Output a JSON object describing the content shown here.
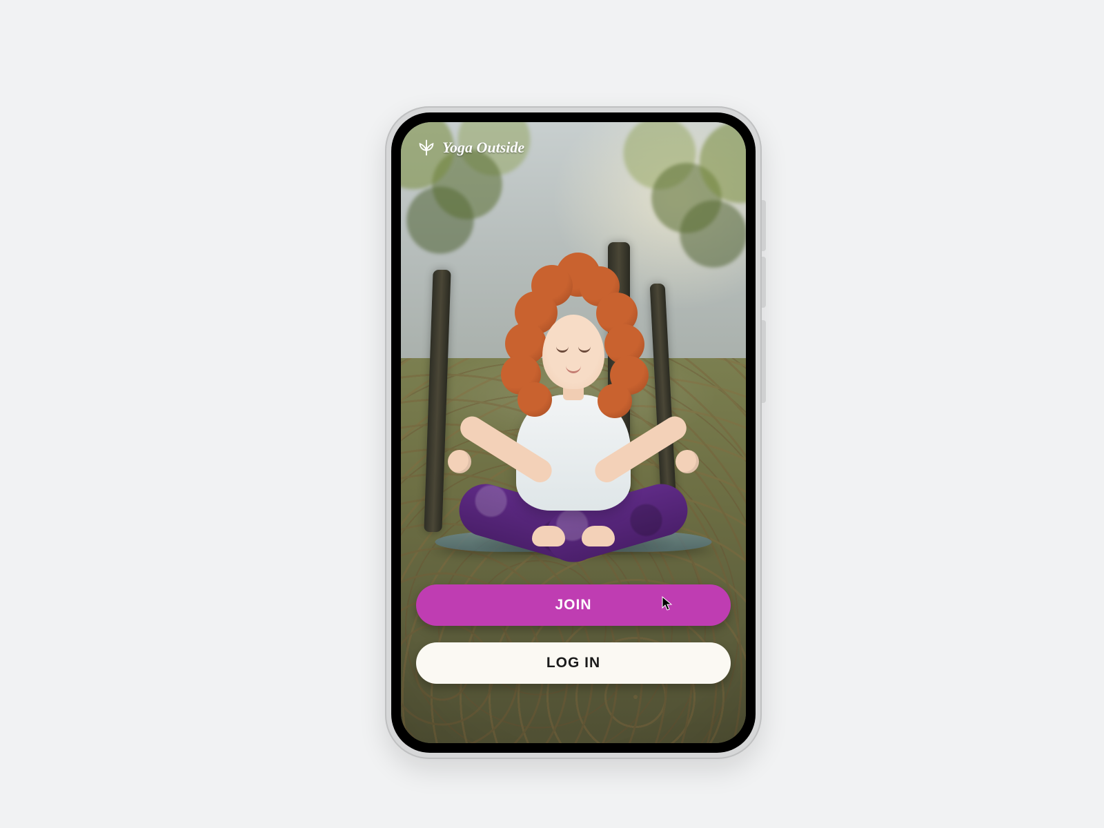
{
  "brand": {
    "name": "Yoga Outside"
  },
  "buttons": {
    "join": "JOIN",
    "login": "LOG IN"
  },
  "colors": {
    "accent": "#bf3db2",
    "secondaryBg": "#fbf9f3"
  }
}
